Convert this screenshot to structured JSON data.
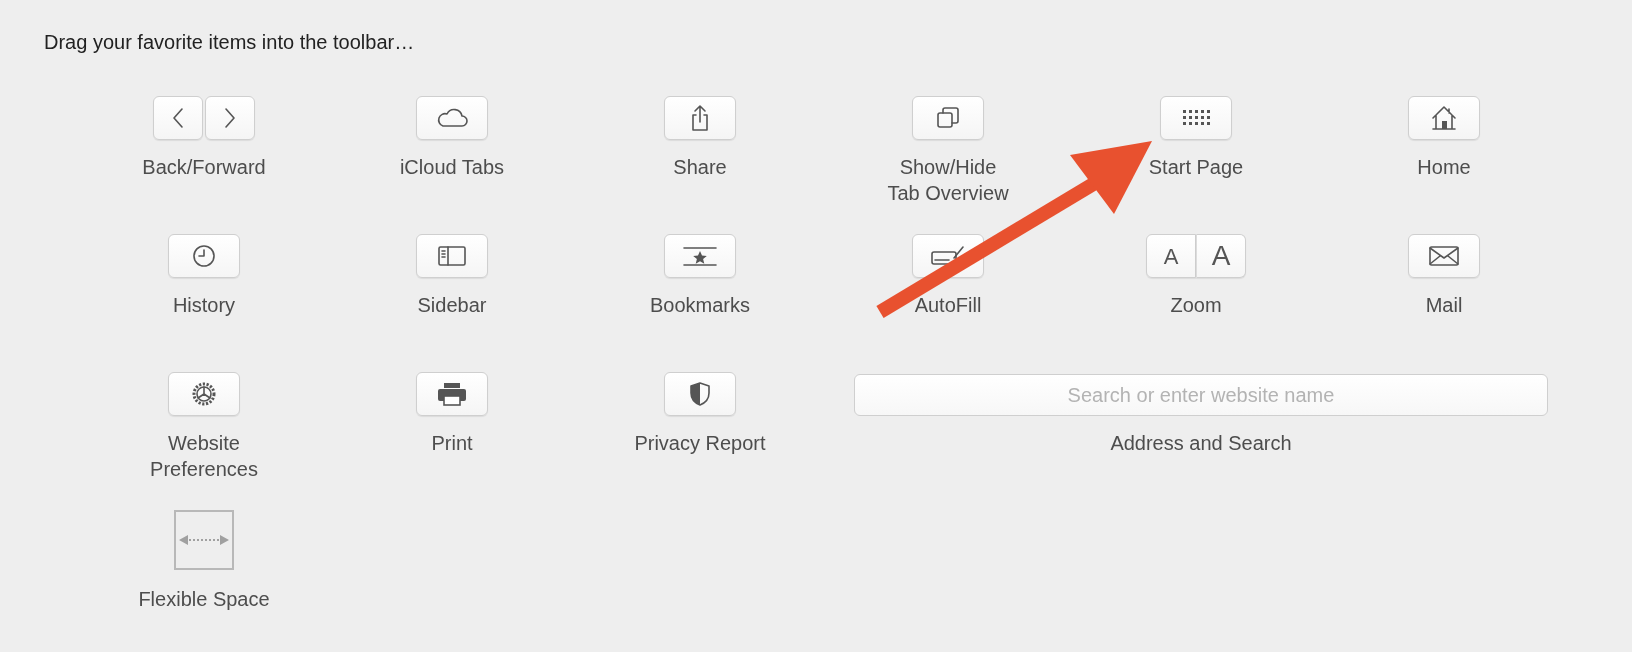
{
  "header": "Drag your favorite items into the toolbar…",
  "items": [
    {
      "kind": "pair",
      "label": "Back/Forward"
    },
    {
      "kind": "button",
      "label": "iCloud Tabs"
    },
    {
      "kind": "button",
      "label": "Share"
    },
    {
      "kind": "button",
      "label": "Show/Hide\nTab Overview"
    },
    {
      "kind": "button",
      "label": "Start Page"
    },
    {
      "kind": "button",
      "label": "Home"
    },
    {
      "kind": "button",
      "label": "History"
    },
    {
      "kind": "button",
      "label": "Sidebar"
    },
    {
      "kind": "button",
      "label": "Bookmarks"
    },
    {
      "kind": "button",
      "label": "AutoFill"
    },
    {
      "kind": "zoom",
      "label": "Zoom",
      "glyphs": [
        "A",
        "A"
      ]
    },
    {
      "kind": "button",
      "label": "Mail"
    },
    {
      "kind": "button",
      "label": "Website\nPreferences"
    },
    {
      "kind": "button",
      "label": "Print"
    },
    {
      "kind": "button",
      "label": "Privacy Report"
    },
    {
      "kind": "field",
      "label": "Address and Search",
      "placeholder": "Search or enter website name"
    },
    {
      "kind": "space",
      "label": "Flexible Space"
    }
  ]
}
